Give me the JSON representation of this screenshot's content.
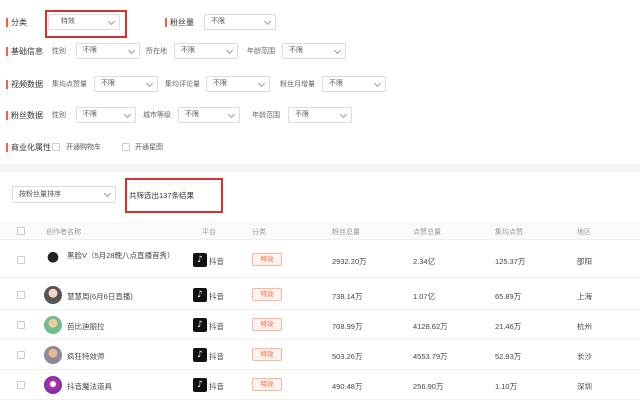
{
  "filters": {
    "category": {
      "label": "分类",
      "value": "特效"
    },
    "fans": {
      "label": "粉丝量",
      "value": "不限"
    },
    "basic": {
      "label": "基础信息",
      "gender": {
        "label": "性别",
        "value": "不限"
      },
      "location": {
        "label": "所在地",
        "value": "不限"
      },
      "age": {
        "label": "年龄范围",
        "value": "不限"
      }
    },
    "video": {
      "label": "视频数据",
      "avg_likes": {
        "label": "集均点赞量",
        "value": "不限"
      },
      "avg_comments": {
        "label": "集均评论量",
        "value": "不限"
      },
      "monthly_growth": {
        "label": "粉丝月增量",
        "value": "不限"
      }
    },
    "fans_data": {
      "label": "粉丝数据",
      "gender": {
        "label": "性别",
        "value": "不限"
      },
      "city_level": {
        "label": "城市等级",
        "value": "不限"
      },
      "age": {
        "label": "年龄范围",
        "value": "不限"
      }
    },
    "commerce": {
      "label": "商业化属性",
      "shop": "开通购物车",
      "star": "开通星图"
    }
  },
  "results": {
    "sort_value": "按粉丝量排序",
    "summary": "共筛选出137条结果"
  },
  "table": {
    "headers": [
      "创作者名称",
      "平台",
      "分类",
      "粉丝总量",
      "点赞总量",
      "集均点赞",
      "地区"
    ],
    "rows": [
      {
        "name": "黑脸V（5月28晚八点直播首秀）",
        "platform": "抖音",
        "category": "特效",
        "fans": "2932.20万",
        "likes": "2.34亿",
        "avg_likes": "125.37万",
        "region": "邵阳"
      },
      {
        "name": "慧慧周(6月6日直播)",
        "platform": "抖音",
        "category": "特效",
        "fans": "738.14万",
        "likes": "1.07亿",
        "avg_likes": "65.89万",
        "region": "上海"
      },
      {
        "name": "芭比迪丽拉",
        "platform": "抖音",
        "category": "特效",
        "fans": "708.99万",
        "likes": "4128.62万",
        "avg_likes": "21.46万",
        "region": "杭州"
      },
      {
        "name": "疯狂特效师",
        "platform": "抖音",
        "category": "特效",
        "fans": "503.26万",
        "likes": "4553.79万",
        "avg_likes": "52.93万",
        "region": "长沙"
      },
      {
        "name": "抖音魔法道具",
        "platform": "抖音",
        "category": "特效",
        "fans": "490.48万",
        "likes": "256.90万",
        "avg_likes": "1.10万",
        "region": "深圳"
      }
    ]
  },
  "colors": {
    "accent": "#ff5c39",
    "highlight_box": "#d9302c",
    "tag_text": "#ff6a3d",
    "tag_bg": "#fff3ef"
  },
  "icons": {
    "platform": "douyin-icon"
  }
}
